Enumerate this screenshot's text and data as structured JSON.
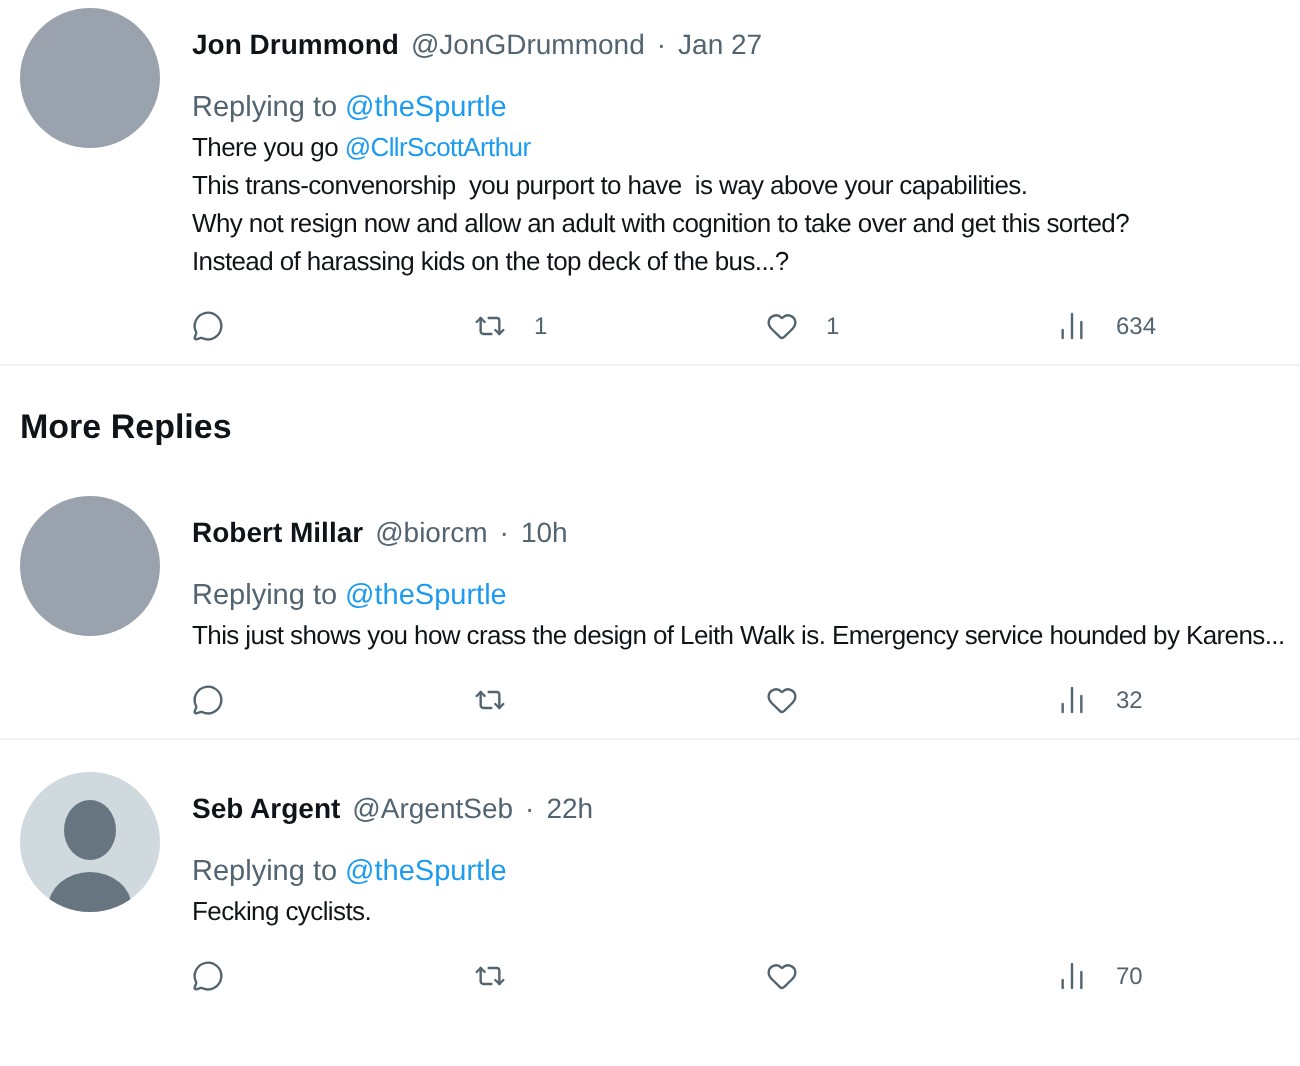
{
  "tweets": [
    {
      "avatar": {
        "kind": "photo"
      },
      "name": "Jon Drummond",
      "handle": "@JonGDrummond",
      "separator": "·",
      "time": "Jan 27",
      "replying_label": "Replying to",
      "replying_to": "@theSpurtle",
      "body": [
        [
          {
            "kind": "text",
            "text": "There you go "
          },
          {
            "kind": "mention",
            "text": "@CllrScottArthur"
          }
        ],
        [
          {
            "kind": "text",
            "text": "This trans-convenorship  you purport to have  is way above your capabilities."
          }
        ],
        [
          {
            "kind": "text",
            "text": "Why not resign now and allow an adult with cognition to take over and get this sorted?"
          }
        ],
        [
          {
            "kind": "text",
            "text": "Instead of harassing kids on the top deck of the bus...?"
          }
        ]
      ],
      "actions": [
        {
          "kind": "reply"
        },
        {
          "kind": "retweet",
          "count": "1"
        },
        {
          "kind": "like",
          "count": "1"
        },
        {
          "kind": "views",
          "count": "634"
        }
      ]
    },
    {
      "kind": "heading",
      "text": "More Replies"
    },
    {
      "avatar": {
        "kind": "photo"
      },
      "name": "Robert Millar",
      "handle": "@biorcm",
      "separator": "·",
      "time": "10h",
      "replying_label": "Replying to",
      "replying_to": "@theSpurtle",
      "body": [
        [
          {
            "kind": "text",
            "text": "This just shows you how crass the design of Leith Walk is. Emergency service hounded by Karens..."
          }
        ]
      ],
      "actions": [
        {
          "kind": "reply"
        },
        {
          "kind": "retweet"
        },
        {
          "kind": "like"
        },
        {
          "kind": "views",
          "count": "32"
        }
      ]
    },
    {
      "avatar": {
        "kind": "default"
      },
      "name": "Seb Argent",
      "handle": "@ArgentSeb",
      "separator": "·",
      "time": "22h",
      "replying_label": "Replying to",
      "replying_to": "@theSpurtle",
      "body": [
        [
          {
            "kind": "text",
            "text": "Fecking cyclists."
          }
        ]
      ],
      "actions": [
        {
          "kind": "reply"
        },
        {
          "kind": "retweet"
        },
        {
          "kind": "like"
        },
        {
          "kind": "views",
          "count": "70"
        }
      ]
    }
  ]
}
